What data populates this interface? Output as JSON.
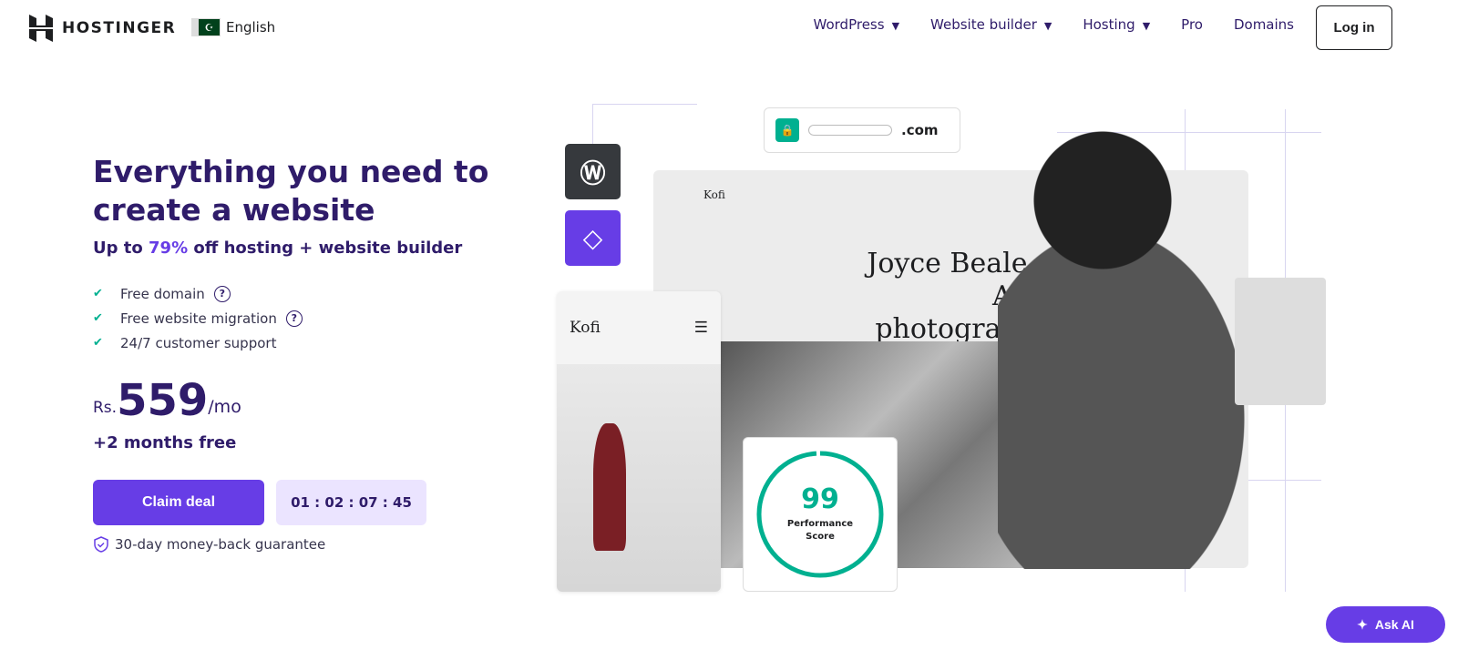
{
  "nav": {
    "brand": "HOSTINGER",
    "language": "English",
    "items": [
      {
        "label": "WordPress",
        "dropdown": true
      },
      {
        "label": "Website builder",
        "dropdown": true
      },
      {
        "label": "Hosting",
        "dropdown": true
      },
      {
        "label": "Pro",
        "dropdown": false
      },
      {
        "label": "Domains",
        "dropdown": false
      }
    ],
    "login": "Log in"
  },
  "hero": {
    "title": "Everything you need to create a website",
    "sub_pre": "Up to ",
    "sub_hl": "79%",
    "sub_post": " off hosting + website builder",
    "features": [
      {
        "label": "Free domain",
        "help": true
      },
      {
        "label": "Free website migration",
        "help": true
      },
      {
        "label": "24/7 customer support",
        "help": false
      }
    ],
    "currency": "Rs.",
    "price": "559",
    "period": "/mo",
    "bonus": "+2 months free",
    "cta": "Claim deal",
    "timer": "01 : 02 : 07 : 45",
    "guarantee": "30-day money-back guarantee"
  },
  "art": {
    "domain": ".com",
    "site_brand": "Kofi",
    "site_name": "Joyce Beale, Art photograph",
    "mobile_brand": "Kofi",
    "score": "99",
    "score_label": "Performance Score",
    "score_value": 99
  },
  "ask_ai": "Ask AI",
  "colors": {
    "primary": "#673de6",
    "dark": "#2f1c6a",
    "success": "#00b090",
    "timer_bg": "#ebe4ff"
  }
}
